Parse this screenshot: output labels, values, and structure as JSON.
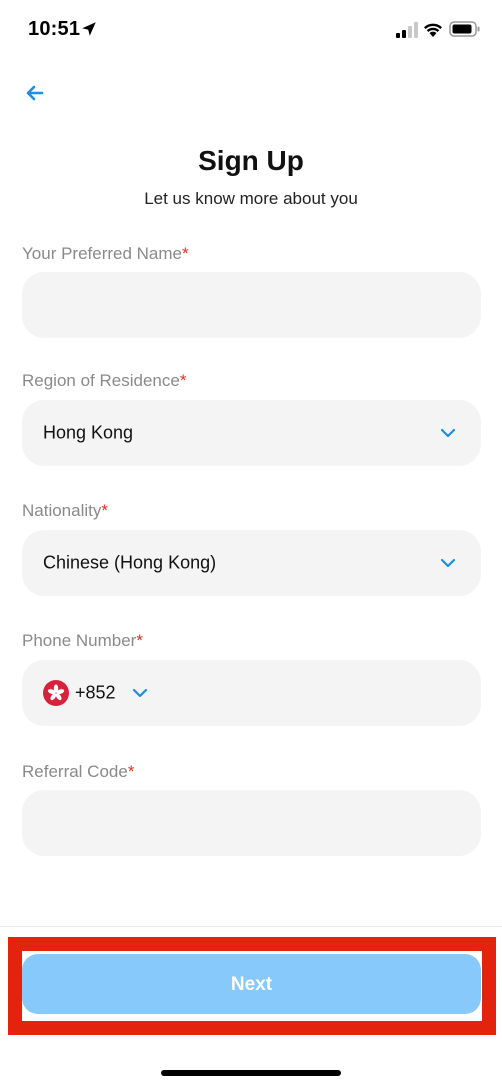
{
  "status_bar": {
    "time": "10:51",
    "location_icon": "location-arrow-icon",
    "signal_icon": "cellular-signal-icon",
    "wifi_icon": "wifi-icon",
    "battery_icon": "battery-icon"
  },
  "nav": {
    "back_icon": "arrow-left-icon"
  },
  "header": {
    "title": "Sign Up",
    "subtitle": "Let us know more about you"
  },
  "fields": {
    "preferred_name": {
      "label": "Your Preferred Name",
      "required_mark": "*",
      "value": ""
    },
    "region": {
      "label": "Region of Residence",
      "required_mark": "*",
      "value": "Hong Kong",
      "icon": "chevron-down-icon"
    },
    "nationality": {
      "label": "Nationality",
      "required_mark": "*",
      "value": "Chinese (Hong Kong)",
      "icon": "chevron-down-icon"
    },
    "phone": {
      "label": "Phone Number",
      "required_mark": "*",
      "flag_icon": "hong-kong-flag-icon",
      "dial_code": "+852",
      "icon": "chevron-down-icon"
    },
    "referral": {
      "label": "Referral Code",
      "required_mark": "*",
      "value": ""
    }
  },
  "footer": {
    "next_label": "Next"
  },
  "colors": {
    "accent": "#1a8fe3",
    "required": "#e0301e",
    "next_button": "#86c9fa",
    "field_bg": "#f4f4f4",
    "highlight": "#e4230f"
  }
}
